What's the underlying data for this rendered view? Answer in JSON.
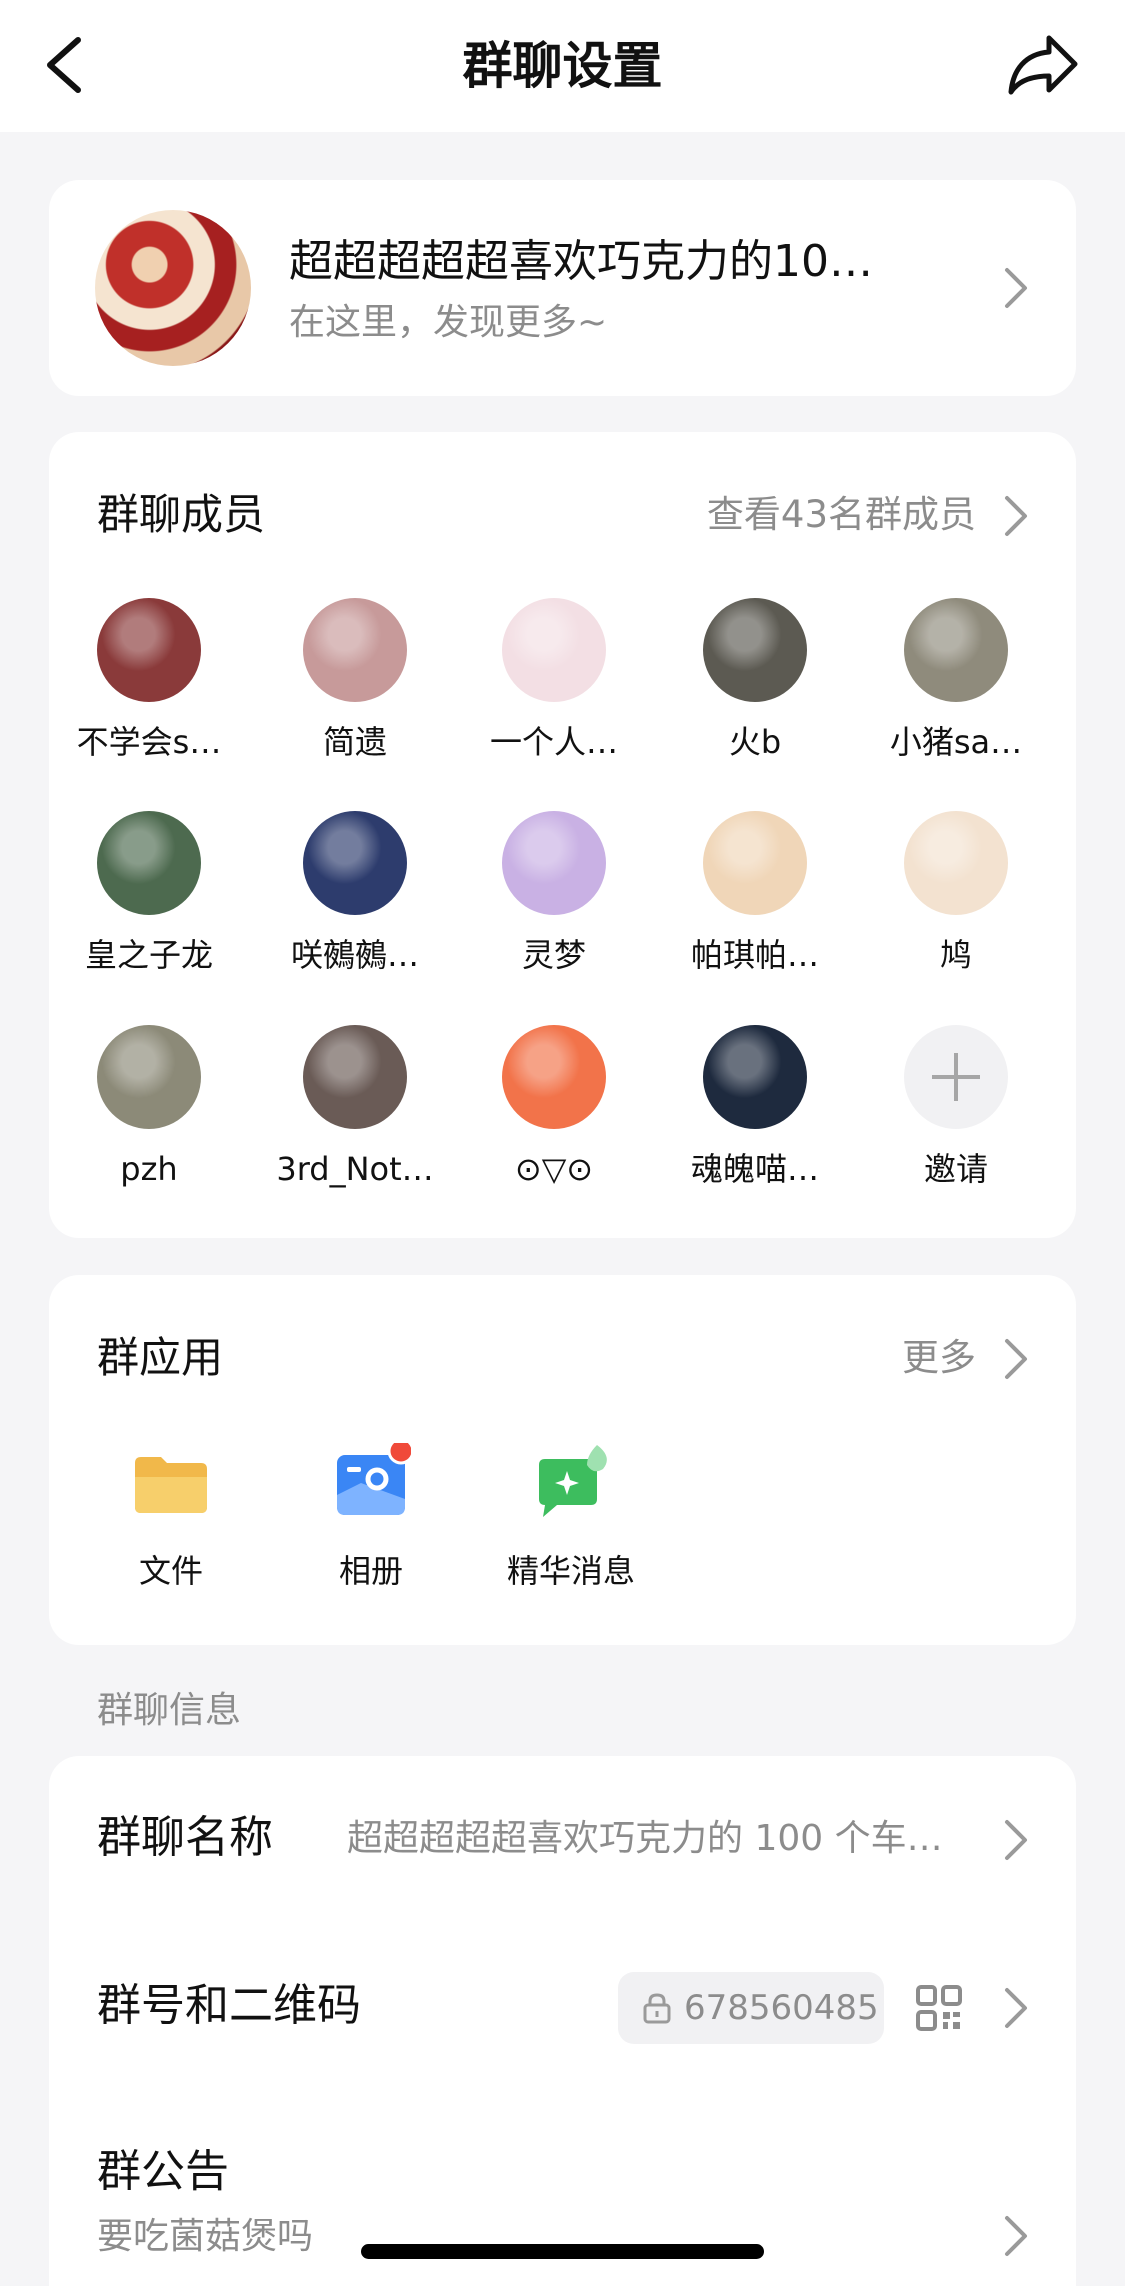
{
  "header": {
    "title": "群聊设置"
  },
  "group": {
    "name": "超超超超超喜欢巧克力的10…",
    "subtitle": "在这里，发现更多~"
  },
  "members": {
    "title": "群聊成员",
    "view_all": "查看43名群成员",
    "list": [
      {
        "name": "不学会s…",
        "color": "#8a3a3a"
      },
      {
        "name": "简遗",
        "color": "#c79a9a"
      },
      {
        "name": "一个人…",
        "color": "#f3dfe4"
      },
      {
        "name": "火b",
        "color": "#5c5a52"
      },
      {
        "name": "小猪sa…",
        "color": "#8f8b7c"
      },
      {
        "name": "皇之子龙",
        "color": "#4d6a4f"
      },
      {
        "name": "咲鵺鵺…",
        "color": "#2d3c6d"
      },
      {
        "name": "灵梦",
        "color": "#c9b1e4"
      },
      {
        "name": "帕琪帕…",
        "color": "#f0d6b8"
      },
      {
        "name": "鸠",
        "color": "#f3e2d0"
      },
      {
        "name": "pzh",
        "color": "#8c8a78"
      },
      {
        "name": "3rd_Not…",
        "color": "#6a5b56"
      },
      {
        "name": "⊙▽⊙",
        "color": "#f2734a"
      },
      {
        "name": "魂魄喵…",
        "color": "#1e2a3e"
      }
    ],
    "invite_label": "邀请"
  },
  "apps": {
    "title": "群应用",
    "more": "更多",
    "items": [
      {
        "label": "文件",
        "icon": "folder-icon"
      },
      {
        "label": "相册",
        "icon": "photo-album-icon"
      },
      {
        "label": "精华消息",
        "icon": "featured-message-icon"
      }
    ]
  },
  "info": {
    "section_label": "群聊信息",
    "name_title": "群聊名称",
    "name_value": "超超超超超喜欢巧克力的 100 个车…",
    "number_title": "群号和二维码",
    "number_value": "678560485",
    "notice_title": "群公告",
    "notice_value": "要吃菌菇煲吗"
  }
}
